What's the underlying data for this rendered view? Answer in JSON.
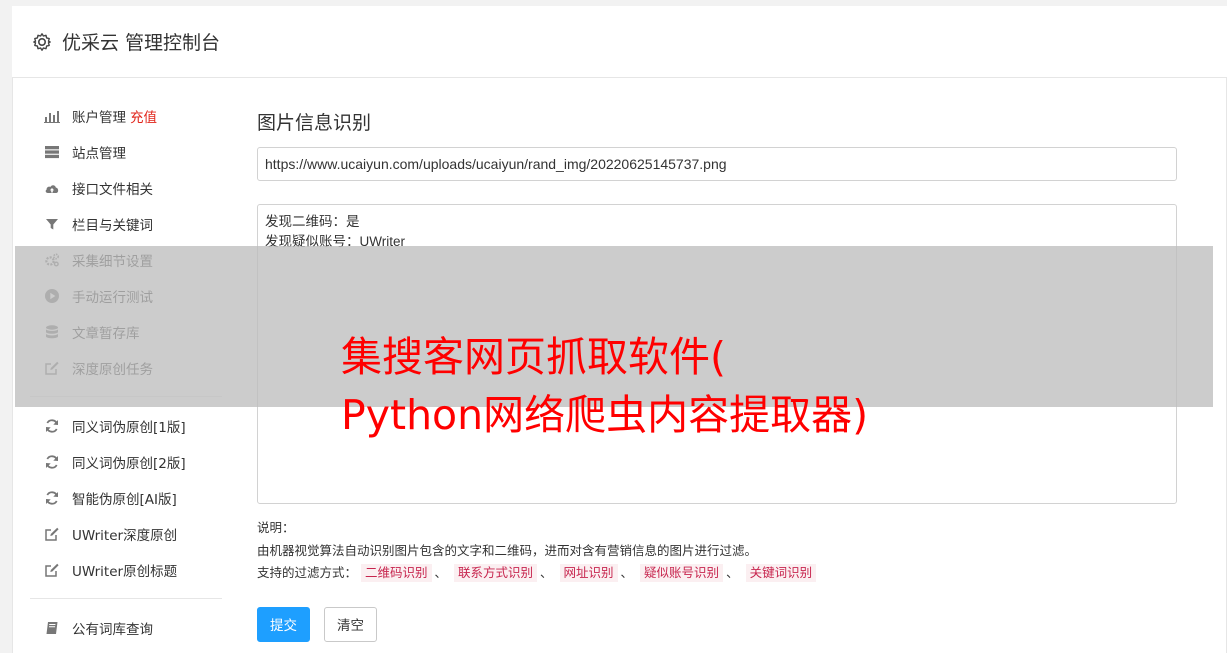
{
  "header": {
    "title": "优采云 管理控制台",
    "icon": "gear-icon"
  },
  "sidebar": {
    "groups": [
      [
        {
          "label": "账户管理",
          "tag": "充值",
          "icon": "bar-chart-icon"
        },
        {
          "label": "站点管理",
          "icon": "server-icon"
        },
        {
          "label": "接口文件相关",
          "icon": "cloud-upload-icon"
        },
        {
          "label": "栏目与关键词",
          "icon": "filter-icon"
        },
        {
          "label": "采集细节设置",
          "icon": "gears-icon"
        },
        {
          "label": "手动运行测试",
          "icon": "play-icon"
        },
        {
          "label": "文章暂存库",
          "icon": "database-icon"
        },
        {
          "label": "深度原创任务",
          "icon": "edit-icon"
        }
      ],
      [
        {
          "label": "同义词伪原创[1版]",
          "icon": "refresh-icon"
        },
        {
          "label": "同义词伪原创[2版]",
          "icon": "refresh-icon"
        },
        {
          "label": "智能伪原创[AI版]",
          "icon": "refresh-icon"
        },
        {
          "label": "UWriter深度原创",
          "icon": "edit-icon"
        },
        {
          "label": "UWriter原创标题",
          "icon": "edit-icon"
        }
      ],
      [
        {
          "label": "公有词库查询",
          "icon": "book-icon"
        }
      ]
    ]
  },
  "main": {
    "title": "图片信息识别",
    "url_value": "https://www.ucaiyun.com/uploads/ucaiyun/rand_img/20220625145737.png",
    "result_lines": [
      "发现二维码：是",
      "发现疑似账号：UWriter"
    ],
    "notes": {
      "heading": "说明：",
      "description": "由机器视觉算法自动识别图片包含的文字和二维码，进而对含有营销信息的图片进行过滤。",
      "filters_label": "支持的过滤方式：",
      "filters": [
        "二维码识别",
        "联系方式识别",
        "网址识别",
        "疑似账号识别",
        "关键词识别"
      ],
      "separator": "、"
    },
    "buttons": {
      "submit": "提交",
      "clear": "清空"
    }
  },
  "overlay": {
    "line1": "集搜客网页抓取软件(",
    "line2": "Python网络爬虫内容提取器)",
    "color": "#ff0000"
  }
}
